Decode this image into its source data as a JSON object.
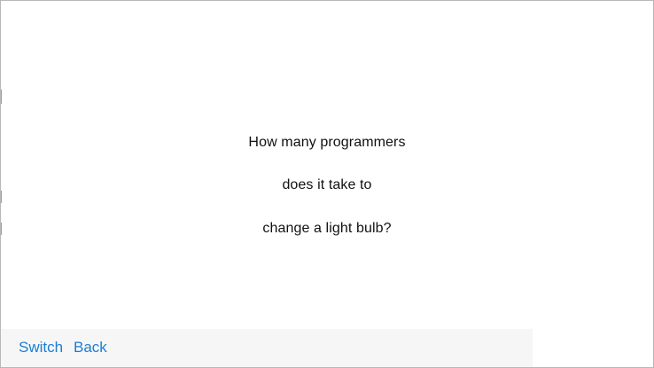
{
  "joke": {
    "lines": [
      "How many programmers",
      "does it take to",
      "change a light bulb?"
    ]
  },
  "toolbar": {
    "switch_label": "Switch",
    "back_label": "Back"
  },
  "colors": {
    "accent": "#1a7ed6",
    "text": "#111111",
    "toolbar_bg": "#f6f6f6",
    "background": "#ffffff"
  }
}
